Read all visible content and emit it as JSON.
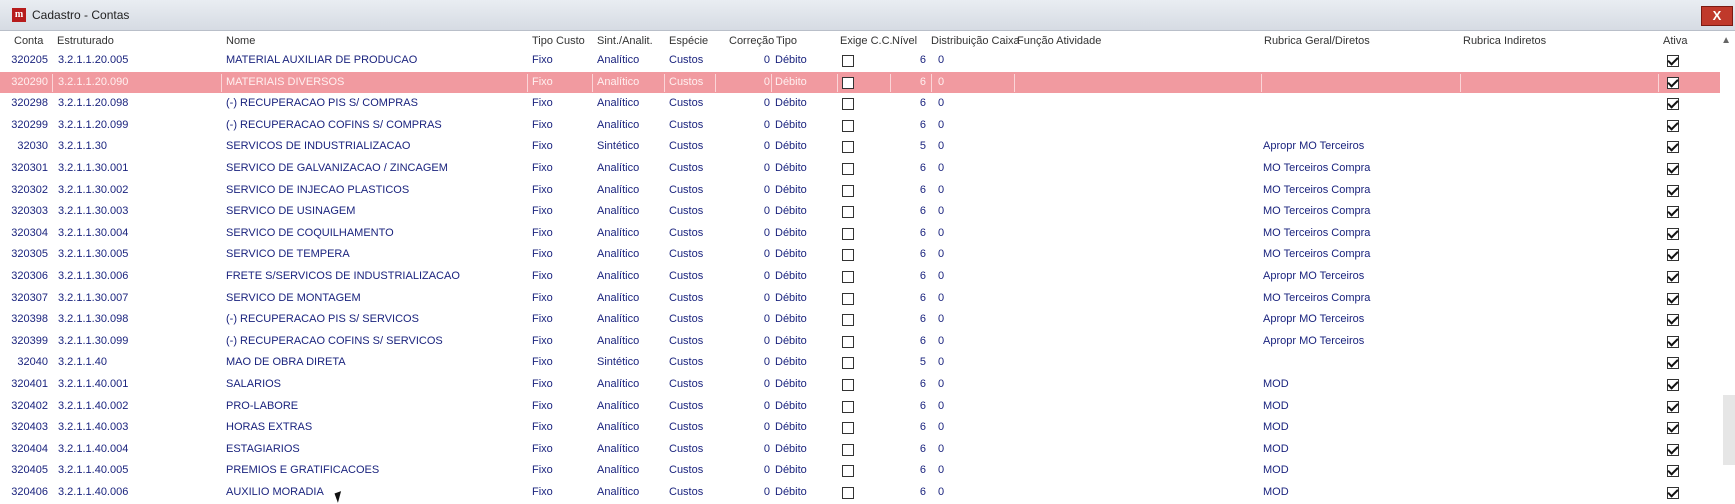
{
  "window": {
    "title": "Cadastro - Contas",
    "close_label": "X"
  },
  "columns": {
    "conta": "Conta",
    "estruturado": "Estruturado",
    "nome": "Nome",
    "tipo_custo": "Tipo Custo",
    "sint_analit": "Sint./Analit.",
    "especie": "Espécie",
    "correcao": "Correção",
    "tipo": "Tipo",
    "exige_cc": "Exige C.C.",
    "nivel": "Nível",
    "distribuicao_caixa": "Distribuição Caixa",
    "funcao_atividade": "Função Atividade",
    "rubrica_geral": "Rubrica Geral/Diretos",
    "rubrica_indiretos": "Rubrica Indiretos",
    "ativa": "Ativa"
  },
  "rows": [
    {
      "conta": "320205",
      "estruturado": "3.2.1.1.20.005",
      "nome": "MATERIAL AUXILIAR DE PRODUCAO",
      "tipo_custo": "Fixo",
      "sint": "Analítico",
      "especie": "Custos",
      "correcao": "0",
      "tipo": "Débito",
      "exige_cc": false,
      "nivel": "6",
      "dist": "0",
      "rubrica": "",
      "ativa": true,
      "selected": false
    },
    {
      "conta": "320290",
      "estruturado": "3.2.1.1.20.090",
      "nome": "MATERIAIS DIVERSOS",
      "tipo_custo": "Fixo",
      "sint": "Analítico",
      "especie": "Custos",
      "correcao": "0",
      "tipo": "Débito",
      "exige_cc": false,
      "nivel": "6",
      "dist": "0",
      "rubrica": "",
      "ativa": true,
      "selected": true
    },
    {
      "conta": "320298",
      "estruturado": "3.2.1.1.20.098",
      "nome": "(-) RECUPERACAO PIS S/ COMPRAS",
      "tipo_custo": "Fixo",
      "sint": "Analítico",
      "especie": "Custos",
      "correcao": "0",
      "tipo": "Débito",
      "exige_cc": false,
      "nivel": "6",
      "dist": "0",
      "rubrica": "",
      "ativa": true,
      "selected": false
    },
    {
      "conta": "320299",
      "estruturado": "3.2.1.1.20.099",
      "nome": "(-) RECUPERACAO COFINS S/ COMPRAS",
      "tipo_custo": "Fixo",
      "sint": "Analítico",
      "especie": "Custos",
      "correcao": "0",
      "tipo": "Débito",
      "exige_cc": false,
      "nivel": "6",
      "dist": "0",
      "rubrica": "",
      "ativa": true,
      "selected": false
    },
    {
      "conta": "32030",
      "estruturado": "3.2.1.1.30",
      "nome": "SERVICOS DE INDUSTRIALIZACAO",
      "tipo_custo": "Fixo",
      "sint": "Sintético",
      "especie": "Custos",
      "correcao": "0",
      "tipo": "Débito",
      "exige_cc": false,
      "nivel": "5",
      "dist": "0",
      "rubrica": "Apropr MO Terceiros",
      "ativa": true,
      "selected": false
    },
    {
      "conta": "320301",
      "estruturado": "3.2.1.1.30.001",
      "nome": "SERVICO DE GALVANIZACAO / ZINCAGEM",
      "tipo_custo": "Fixo",
      "sint": "Analítico",
      "especie": "Custos",
      "correcao": "0",
      "tipo": "Débito",
      "exige_cc": false,
      "nivel": "6",
      "dist": "0",
      "rubrica": "MO Terceiros Compra",
      "ativa": true,
      "selected": false
    },
    {
      "conta": "320302",
      "estruturado": "3.2.1.1.30.002",
      "nome": "SERVICO DE INJECAO PLASTICOS",
      "tipo_custo": "Fixo",
      "sint": "Analítico",
      "especie": "Custos",
      "correcao": "0",
      "tipo": "Débito",
      "exige_cc": false,
      "nivel": "6",
      "dist": "0",
      "rubrica": "MO Terceiros Compra",
      "ativa": true,
      "selected": false
    },
    {
      "conta": "320303",
      "estruturado": "3.2.1.1.30.003",
      "nome": "SERVICO DE USINAGEM",
      "tipo_custo": "Fixo",
      "sint": "Analítico",
      "especie": "Custos",
      "correcao": "0",
      "tipo": "Débito",
      "exige_cc": false,
      "nivel": "6",
      "dist": "0",
      "rubrica": "MO Terceiros Compra",
      "ativa": true,
      "selected": false
    },
    {
      "conta": "320304",
      "estruturado": "3.2.1.1.30.004",
      "nome": "SERVICO DE COQUILHAMENTO",
      "tipo_custo": "Fixo",
      "sint": "Analítico",
      "especie": "Custos",
      "correcao": "0",
      "tipo": "Débito",
      "exige_cc": false,
      "nivel": "6",
      "dist": "0",
      "rubrica": "MO Terceiros Compra",
      "ativa": true,
      "selected": false
    },
    {
      "conta": "320305",
      "estruturado": "3.2.1.1.30.005",
      "nome": "SERVICO DE TEMPERA",
      "tipo_custo": "Fixo",
      "sint": "Analítico",
      "especie": "Custos",
      "correcao": "0",
      "tipo": "Débito",
      "exige_cc": false,
      "nivel": "6",
      "dist": "0",
      "rubrica": "MO Terceiros Compra",
      "ativa": true,
      "selected": false
    },
    {
      "conta": "320306",
      "estruturado": "3.2.1.1.30.006",
      "nome": "FRETE S/SERVICOS DE INDUSTRIALIZACAO",
      "tipo_custo": "Fixo",
      "sint": "Analítico",
      "especie": "Custos",
      "correcao": "0",
      "tipo": "Débito",
      "exige_cc": false,
      "nivel": "6",
      "dist": "0",
      "rubrica": "Apropr MO Terceiros",
      "ativa": true,
      "selected": false
    },
    {
      "conta": "320307",
      "estruturado": "3.2.1.1.30.007",
      "nome": "SERVICO DE MONTAGEM",
      "tipo_custo": "Fixo",
      "sint": "Analítico",
      "especie": "Custos",
      "correcao": "0",
      "tipo": "Débito",
      "exige_cc": false,
      "nivel": "6",
      "dist": "0",
      "rubrica": "MO Terceiros Compra",
      "ativa": true,
      "selected": false
    },
    {
      "conta": "320398",
      "estruturado": "3.2.1.1.30.098",
      "nome": "(-) RECUPERACAO PIS S/ SERVICOS",
      "tipo_custo": "Fixo",
      "sint": "Analítico",
      "especie": "Custos",
      "correcao": "0",
      "tipo": "Débito",
      "exige_cc": false,
      "nivel": "6",
      "dist": "0",
      "rubrica": "Apropr MO Terceiros",
      "ativa": true,
      "selected": false
    },
    {
      "conta": "320399",
      "estruturado": "3.2.1.1.30.099",
      "nome": "(-) RECUPERACAO COFINS S/ SERVICOS",
      "tipo_custo": "Fixo",
      "sint": "Analítico",
      "especie": "Custos",
      "correcao": "0",
      "tipo": "Débito",
      "exige_cc": false,
      "nivel": "6",
      "dist": "0",
      "rubrica": "Apropr MO Terceiros",
      "ativa": true,
      "selected": false
    },
    {
      "conta": "32040",
      "estruturado": "3.2.1.1.40",
      "nome": "MAO DE OBRA DIRETA",
      "tipo_custo": "Fixo",
      "sint": "Sintético",
      "especie": "Custos",
      "correcao": "0",
      "tipo": "Débito",
      "exige_cc": false,
      "nivel": "5",
      "dist": "0",
      "rubrica": "",
      "ativa": true,
      "selected": false
    },
    {
      "conta": "320401",
      "estruturado": "3.2.1.1.40.001",
      "nome": "SALARIOS",
      "tipo_custo": "Fixo",
      "sint": "Analítico",
      "especie": "Custos",
      "correcao": "0",
      "tipo": "Débito",
      "exige_cc": false,
      "nivel": "6",
      "dist": "0",
      "rubrica": "MOD",
      "ativa": true,
      "selected": false
    },
    {
      "conta": "320402",
      "estruturado": "3.2.1.1.40.002",
      "nome": "PRO-LABORE",
      "tipo_custo": "Fixo",
      "sint": "Analítico",
      "especie": "Custos",
      "correcao": "0",
      "tipo": "Débito",
      "exige_cc": false,
      "nivel": "6",
      "dist": "0",
      "rubrica": "MOD",
      "ativa": true,
      "selected": false
    },
    {
      "conta": "320403",
      "estruturado": "3.2.1.1.40.003",
      "nome": "HORAS EXTRAS",
      "tipo_custo": "Fixo",
      "sint": "Analítico",
      "especie": "Custos",
      "correcao": "0",
      "tipo": "Débito",
      "exige_cc": false,
      "nivel": "6",
      "dist": "0",
      "rubrica": "MOD",
      "ativa": true,
      "selected": false
    },
    {
      "conta": "320404",
      "estruturado": "3.2.1.1.40.004",
      "nome": "ESTAGIARIOS",
      "tipo_custo": "Fixo",
      "sint": "Analítico",
      "especie": "Custos",
      "correcao": "0",
      "tipo": "Débito",
      "exige_cc": false,
      "nivel": "6",
      "dist": "0",
      "rubrica": "MOD",
      "ativa": true,
      "selected": false
    },
    {
      "conta": "320405",
      "estruturado": "3.2.1.1.40.005",
      "nome": "PREMIOS E GRATIFICACOES",
      "tipo_custo": "Fixo",
      "sint": "Analítico",
      "especie": "Custos",
      "correcao": "0",
      "tipo": "Débito",
      "exige_cc": false,
      "nivel": "6",
      "dist": "0",
      "rubrica": "MOD",
      "ativa": true,
      "selected": false
    },
    {
      "conta": "320406",
      "estruturado": "3.2.1.1.40.006",
      "nome": "AUXILIO MORADIA",
      "tipo_custo": "Fixo",
      "sint": "Analítico",
      "especie": "Custos",
      "correcao": "0",
      "tipo": "Débito",
      "exige_cc": false,
      "nivel": "6",
      "dist": "0",
      "rubrica": "MOD",
      "ativa": true,
      "selected": false
    }
  ]
}
